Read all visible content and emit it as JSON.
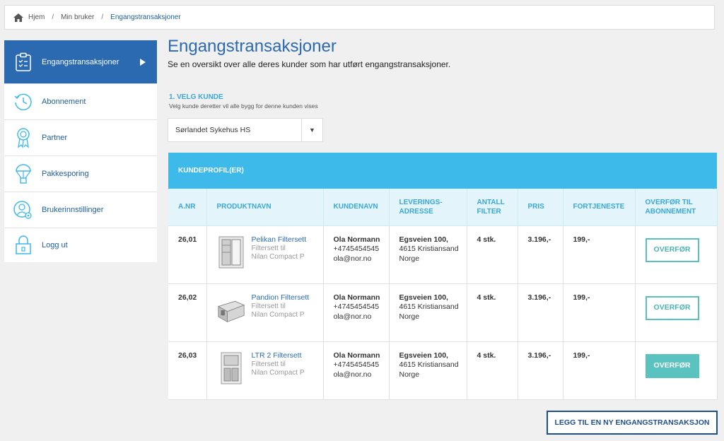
{
  "breadcrumb": {
    "items": [
      "Hjem",
      "Min bruker",
      "Engangstransaksjoner"
    ],
    "separator": "/"
  },
  "sidebar": {
    "items": [
      {
        "label": "Engangstransaksjoner",
        "icon": "clipboard-icon",
        "active": true
      },
      {
        "label": "Abonnement",
        "icon": "clock-icon"
      },
      {
        "label": "Partner",
        "icon": "award-icon"
      },
      {
        "label": "Pakkesporing",
        "icon": "parachute-icon"
      },
      {
        "label": "Brukerinnstillinger",
        "icon": "user-settings-icon"
      },
      {
        "label": "Logg ut",
        "icon": "lock-icon"
      }
    ]
  },
  "main": {
    "title": "Engangstransaksjoner",
    "subtitle": "Se en oversikt over alle deres kunder som har utført engangstransaksjoner.",
    "step_title": "1. VELG KUNDE",
    "step_help": "Velg kunde deretter vil alle bygg for denne kunden vises",
    "customer_select": {
      "value": "Sørlandet Sykehus HS"
    }
  },
  "table": {
    "heading": "KUNDEPROFIL(ER)",
    "columns": [
      "A.NR",
      "PRODUKTNAVN",
      "KUNDENAVN",
      "LEVERINGS-ADRESSE",
      "ANTALL FILTER",
      "PRIS",
      "FORTJENESTE",
      "OVERFØR TIL ABONNEMENT"
    ],
    "rows": [
      {
        "nr": "26,01",
        "product": "Pelikan Filtersett",
        "desc1": "Filtersett til",
        "desc2": "Nilan Compact P",
        "name": "Ola Normann",
        "phone": "+4745454545",
        "email": "ola@nor.no",
        "addr1": "Egsveien 100,",
        "addr2": "4615 Kristiansand",
        "addr3": "Norge",
        "qty": "4 stk.",
        "price": "3.196,-",
        "profit": "199,-",
        "action": "OVERFØR"
      },
      {
        "nr": "26,02",
        "product": "Pandion Filtersett",
        "desc1": "Filtersett til",
        "desc2": "Nilan Compact P",
        "name": "Ola Normann",
        "phone": "+4745454545",
        "email": "ola@nor.no",
        "addr1": "Egsveien 100,",
        "addr2": "4615 Kristiansand",
        "addr3": "Norge",
        "qty": "4 stk.",
        "price": "3.196,-",
        "profit": "199,-",
        "action": "OVERFØR"
      },
      {
        "nr": "26,03",
        "product": "LTR 2 Filtersett",
        "desc1": "Filtersett til",
        "desc2": "Nilan Compact P",
        "name": "Ola Normann",
        "phone": "+4745454545",
        "email": "ola@nor.no",
        "addr1": "Egsveien 100,",
        "addr2": "4615 Kristiansand",
        "addr3": "Norge",
        "qty": "4 stk.",
        "price": "3.196,-",
        "profit": "199,-",
        "action": "OVERFØR"
      }
    ]
  },
  "add_button": "LEGG TIL EN NY ENGANGSTRANSAKSJON",
  "colors": {
    "primary": "#2b6ab0",
    "accent": "#3db9ea",
    "teal": "#5ac3c0"
  }
}
